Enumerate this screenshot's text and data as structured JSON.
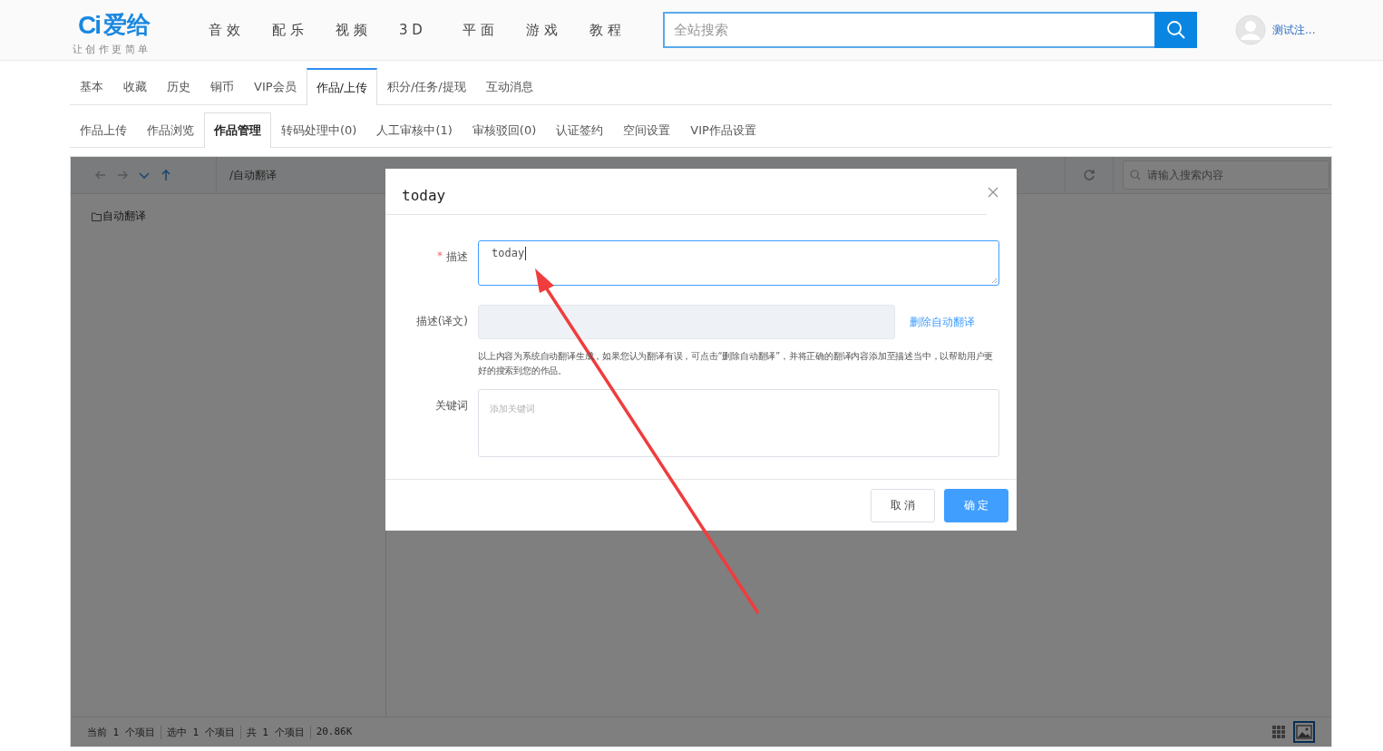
{
  "header": {
    "logo": {
      "mark": "Ci",
      "name": "爱给",
      "slogan": "让 创 作 更 简 单"
    },
    "nav": [
      "音 效",
      "配 乐",
      "视 频",
      "3 D",
      "平 面",
      "游 戏",
      "教 程"
    ],
    "search": {
      "placeholder": "全站搜索"
    },
    "user": {
      "name": "测试注..."
    }
  },
  "tabs": [
    {
      "label": "基本",
      "selected": false
    },
    {
      "label": "收藏",
      "selected": false
    },
    {
      "label": "历史",
      "selected": false
    },
    {
      "label": "铜币",
      "selected": false
    },
    {
      "label": "VIP会员",
      "selected": false
    },
    {
      "label": "作品/上传",
      "selected": true
    },
    {
      "label": "积分/任务/提现",
      "selected": false
    },
    {
      "label": "互动消息",
      "selected": false
    }
  ],
  "subtabs": [
    {
      "label": "作品上传",
      "selected": false
    },
    {
      "label": "作品浏览",
      "selected": false
    },
    {
      "label": "作品管理",
      "selected": true
    },
    {
      "label": "转码处理中(0)",
      "selected": false
    },
    {
      "label": "人工审核中(1)",
      "selected": false
    },
    {
      "label": "审核驳回(0)",
      "selected": false
    },
    {
      "label": "认证签约",
      "selected": false
    },
    {
      "label": "空间设置",
      "selected": false
    },
    {
      "label": "VIP作品设置",
      "selected": false
    }
  ],
  "file_manager": {
    "nav_buttons": [
      {
        "kind": "back",
        "disabled": true
      },
      {
        "kind": "forward",
        "disabled": true
      },
      {
        "kind": "down",
        "disabled": false
      },
      {
        "kind": "up",
        "disabled": false
      }
    ],
    "path": "/自动翻译",
    "search": {
      "placeholder": "请输入搜索内容"
    },
    "tree": [
      {
        "label": "自动翻译"
      }
    ],
    "status": [
      "当前 1 个项目",
      "选中 1 个项目",
      "共 1 个项目",
      "20.86K"
    ],
    "views": [
      {
        "kind": "grid",
        "selected": false
      },
      {
        "kind": "picture",
        "selected": true
      }
    ]
  },
  "dialog": {
    "title": "today",
    "fields": [
      {
        "kind": "textarea",
        "label": "描述",
        "required_mark": "*",
        "value": "today ",
        "focused": true
      },
      {
        "kind": "input",
        "label": "描述(译文)",
        "disabled": true,
        "link": "删除自动翻译"
      },
      {
        "kind": "hint",
        "text": "以上内容为系统自动翻译生成，如果您认为翻译有误，可点击“删除自动翻译”，并将正确的翻译内容添加至描述当中，以帮助用户更好的搜索到您的作品。"
      },
      {
        "kind": "tags",
        "label": "关键词",
        "placeholder": "添加关键词"
      }
    ],
    "buttons": [
      {
        "label": "取 消",
        "kind": "default"
      },
      {
        "label": "确 定",
        "kind": "primary"
      }
    ]
  }
}
